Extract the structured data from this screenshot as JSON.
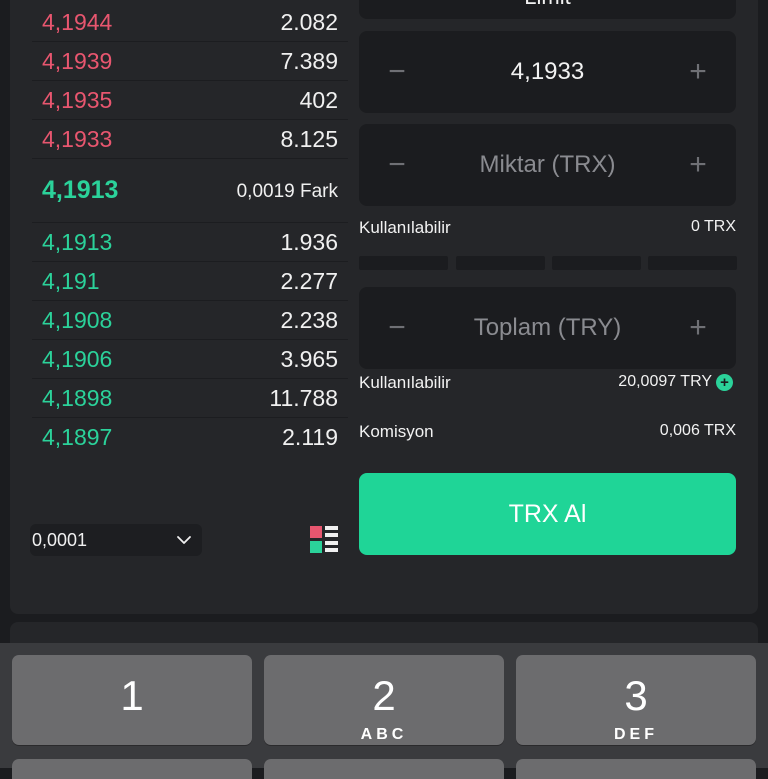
{
  "order_book": {
    "asks": [
      {
        "price": "4,1944",
        "amount": "2.082"
      },
      {
        "price": "4,1939",
        "amount": "7.389"
      },
      {
        "price": "4,1935",
        "amount": "402"
      },
      {
        "price": "4,1933",
        "amount": "8.125"
      }
    ],
    "last_price": "4,1913",
    "spread": "0,0019 Fark",
    "bids": [
      {
        "price": "4,1913",
        "amount": "1.936"
      },
      {
        "price": "4,191",
        "amount": "2.277"
      },
      {
        "price": "4,1908",
        "amount": "2.238"
      },
      {
        "price": "4,1906",
        "amount": "3.965"
      },
      {
        "price": "4,1898",
        "amount": "11.788"
      },
      {
        "price": "4,1897",
        "amount": "2.119"
      }
    ],
    "step_value": "0,0001"
  },
  "order_form": {
    "order_type": "Limit",
    "price_value": "4,1933",
    "amount_placeholder": "Miktar (TRX)",
    "available_label": "Kullanılabilir",
    "available_trx": "0 TRX",
    "total_placeholder": "Toplam (TRY)",
    "available_try": "20,0097 TRY",
    "commission_label": "Komisyon",
    "commission_value": "0,006 TRX",
    "buy_button": "TRX Al",
    "minus_symbol": "−",
    "plus_symbol": "+"
  },
  "keyboard": {
    "keys": [
      {
        "num": "1",
        "letters": ""
      },
      {
        "num": "2",
        "letters": "ABC"
      },
      {
        "num": "3",
        "letters": "DEF"
      }
    ]
  },
  "colors": {
    "ask": "#e8566f",
    "bid": "#2bd29a",
    "buy_button": "#1fd597"
  }
}
